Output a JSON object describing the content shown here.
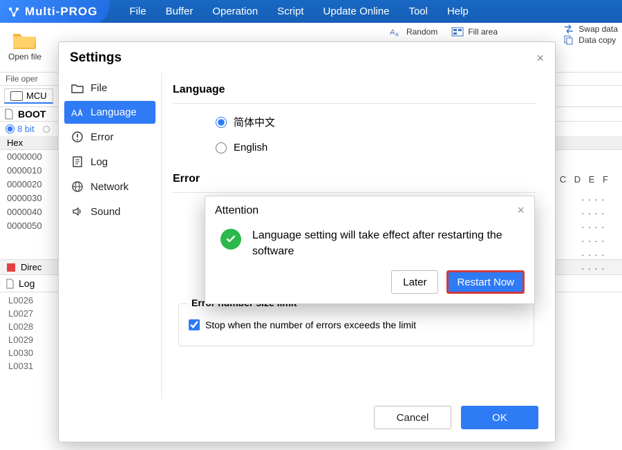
{
  "brand": "Multi-PROG",
  "menu": {
    "file": "File",
    "buffer": "Buffer",
    "operation": "Operation",
    "script": "Script",
    "update": "Update Online",
    "tool": "Tool",
    "help": "Help"
  },
  "toolbar": {
    "open_file": "Open file",
    "random": "Random",
    "fill_area": "Fill area",
    "swap_data": "Swap data",
    "data_copy": "Data copy"
  },
  "status_strip": "File oper",
  "tabs": {
    "mcu": "MCU",
    "boot": "BOOT",
    "bits": "8 bit",
    "hex": "Hex"
  },
  "hex_cols_right": "C D E F",
  "hex_rows": [
    "0000000",
    "0000010",
    "0000020",
    "0000030",
    "0000040",
    "0000050"
  ],
  "dots_rows": [
    "....",
    "....",
    "....",
    "....",
    "....",
    "...."
  ],
  "direc": "Direc",
  "log": {
    "title": "Log",
    "lines": [
      "L0026",
      "L0027",
      "L0028",
      "L0029",
      "L0030",
      "L0031"
    ]
  },
  "settings": {
    "title": "Settings",
    "sidebar": {
      "file": "File",
      "language": "Language",
      "error": "Error",
      "log": "Log",
      "network": "Network",
      "sound": "Sound"
    },
    "section_language": "Language",
    "lang_cn": "简体中文",
    "lang_en": "English",
    "section_error": "Error",
    "error_limit_legend": "Error number size limit",
    "error_limit_checkbox": "Stop when the number of errors exceeds the limit",
    "cancel": "Cancel",
    "ok": "OK"
  },
  "attention": {
    "title": "Attention",
    "message": "Language setting will take effect after restarting the software",
    "later": "Later",
    "restart": "Restart Now"
  }
}
